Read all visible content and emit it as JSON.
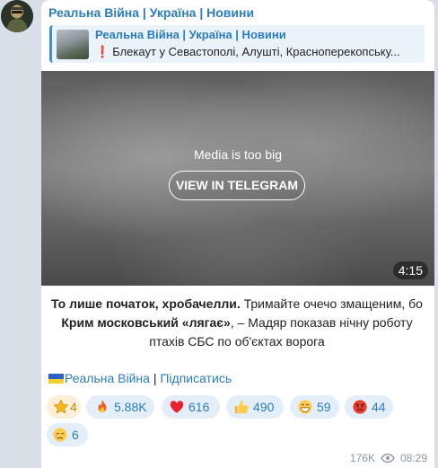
{
  "channel": {
    "name": "Реальна Війна | Україна | Новини"
  },
  "reply": {
    "title": "Реальна Війна | Україна | Новини",
    "excerpt": "Блекаут у Севастополі, Алушті, Красноперекопську..."
  },
  "media": {
    "notice": "Media is too big",
    "button_label": "VIEW IN TELEGRAM",
    "duration": "4:15"
  },
  "caption": {
    "part1_bold": "То лише початок, хробачелли.",
    "part2": " Тримайте очечо змащеним, бо ",
    "part3_bold": "Крим московський «лягає»",
    "part4": ", – Мадяр показав нічну роботу птахів СБС по об'єктах ворога"
  },
  "subscribe": {
    "channel_link": "Реальна Війна",
    "separator": " | ",
    "subscribe_link": "Підписатись"
  },
  "reactions": [
    {
      "emoji": "star-icon",
      "count": "4",
      "paid": true
    },
    {
      "emoji": "fire-icon",
      "count": "5.88K"
    },
    {
      "emoji": "heart-icon",
      "count": "616"
    },
    {
      "emoji": "thumbs-up-icon",
      "count": "490"
    },
    {
      "emoji": "grin-icon",
      "count": "59"
    },
    {
      "emoji": "angry-face-icon",
      "count": "44"
    },
    {
      "emoji": "crying-face-icon",
      "count": "6"
    }
  ],
  "meta": {
    "views": "176K",
    "time": "08:29"
  },
  "colors": {
    "accent": "#2b7cc1",
    "background": "#d9dfe6",
    "bubble": "#ffffff",
    "reaction_bg": "#e4eef8"
  }
}
